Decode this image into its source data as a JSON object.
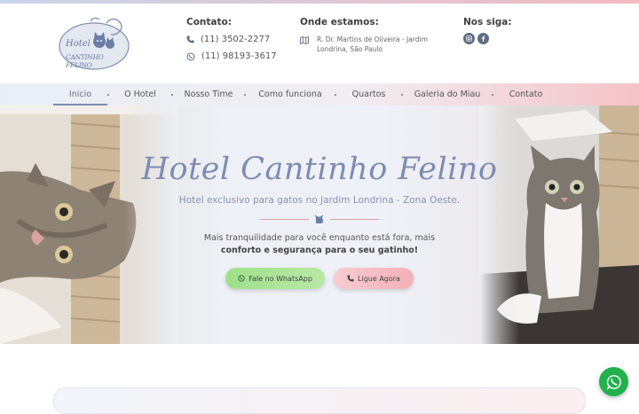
{
  "brand": {
    "logo_line1": "Hotel",
    "logo_line2": "CANTINHO FELINO"
  },
  "header": {
    "contact_title": "Contato:",
    "phone": "(11) 3502-2277",
    "whatsapp": "(11) 98193-3617",
    "address_title": "Onde estamos:",
    "address": "R. Dr. Martins de Oliveira - Jardim Londrina, São Paulo",
    "social_title": "Nos siga:",
    "social_icons": [
      "instagram-icon",
      "facebook-icon"
    ]
  },
  "nav": {
    "items": [
      "Inicio",
      "O Hotel",
      "Nosso Time",
      "Como funciona",
      "Quartos",
      "Galeria do Miau",
      "Contato"
    ],
    "active": "Inicio"
  },
  "hero": {
    "title": "Hotel Cantinho Felino",
    "subtitle": "Hotel exclusivo para gatos no Jardim Londrina - Zona Oeste.",
    "text_part1": "Mais tranquilidade para você enquanto está fora, mais ",
    "text_bold1": "conforto e segurança para o seu gatinho!",
    "btn_whatsapp": "Fale no WhatsApp",
    "btn_call": "Ligue Agora"
  },
  "colors": {
    "accent_blue": "#7e8cb2",
    "accent_pink": "#f3b1b8",
    "whatsapp_green": "#22b14c",
    "button_green": "#9fe08a"
  }
}
